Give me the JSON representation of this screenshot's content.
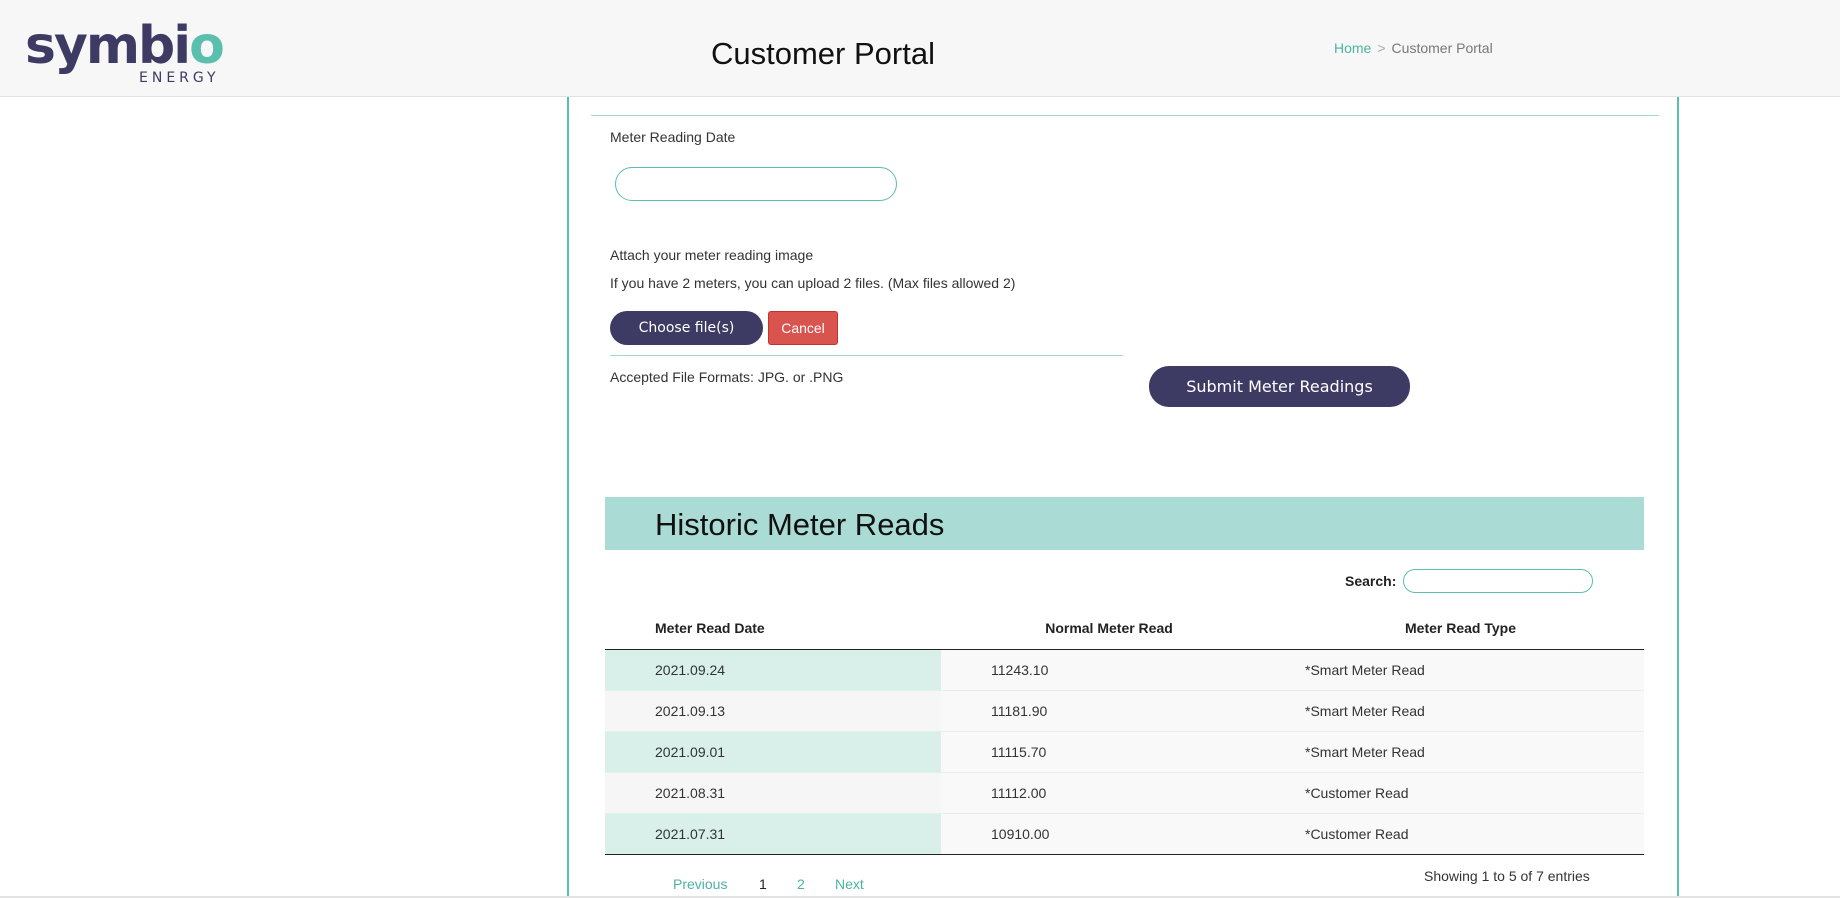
{
  "brand": {
    "name_part1": "symbi",
    "name_part2": "o",
    "sub": "ENERGY"
  },
  "header": {
    "title": "Customer Portal",
    "breadcrumb": {
      "home": "Home",
      "separator": ">",
      "current": "Customer Portal"
    }
  },
  "form": {
    "date_label": "Meter Reading Date",
    "date_value": "",
    "attach_label": "Attach your meter reading image",
    "attach_hint": "If you have 2 meters, you can upload 2 files. (Max files allowed 2)",
    "choose_label": "Choose file(s)",
    "cancel_label": "Cancel",
    "formats_label": "Accepted File Formats: JPG. or .PNG",
    "submit_label": "Submit Meter Readings"
  },
  "history": {
    "title": "Historic Meter Reads",
    "search_label": "Search:",
    "search_value": "",
    "columns": [
      "Meter Read Date",
      "Normal Meter Read",
      "Meter Read Type"
    ],
    "rows": [
      [
        "2021.09.24",
        "11243.10",
        "*Smart Meter Read"
      ],
      [
        "2021.09.13",
        "11181.90",
        "*Smart Meter Read"
      ],
      [
        "2021.09.01",
        "11115.70",
        "*Smart Meter Read"
      ],
      [
        "2021.08.31",
        "11112.00",
        "*Customer Read"
      ],
      [
        "2021.07.31",
        "10910.00",
        "*Customer Read"
      ]
    ],
    "pagination": {
      "previous": "Previous",
      "pages": [
        "1",
        "2"
      ],
      "current": "1",
      "next": "Next"
    },
    "entries_info": "Showing 1 to 5 of 7 entries"
  },
  "colors": {
    "accent": "#5bbfae",
    "brand_dark": "#3d3b63",
    "banner": "#aadcd5",
    "cancel": "#d9534f"
  }
}
